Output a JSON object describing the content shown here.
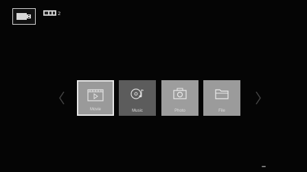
{
  "status_bar": {
    "source_icon": "usb-device-icon",
    "secondary_icon": "storage-device-icon",
    "secondary_label": "2"
  },
  "navigation": {
    "left_icon": "chevron-left-icon",
    "right_icon": "chevron-right-icon"
  },
  "media_tiles": [
    {
      "label": "Movie",
      "icon": "film-icon",
      "selected": true
    },
    {
      "label": "Music",
      "icon": "music-disc-icon",
      "selected": false
    },
    {
      "label": "Photo",
      "icon": "camera-icon",
      "selected": false
    },
    {
      "label": "File",
      "icon": "folder-icon",
      "selected": false
    }
  ],
  "colors": {
    "background": "#050505",
    "selected_border": "#e8e8e8",
    "tile_gray": "#9a9a9a",
    "tile_dark": "#5c5c5c",
    "chevron": "#444444"
  }
}
